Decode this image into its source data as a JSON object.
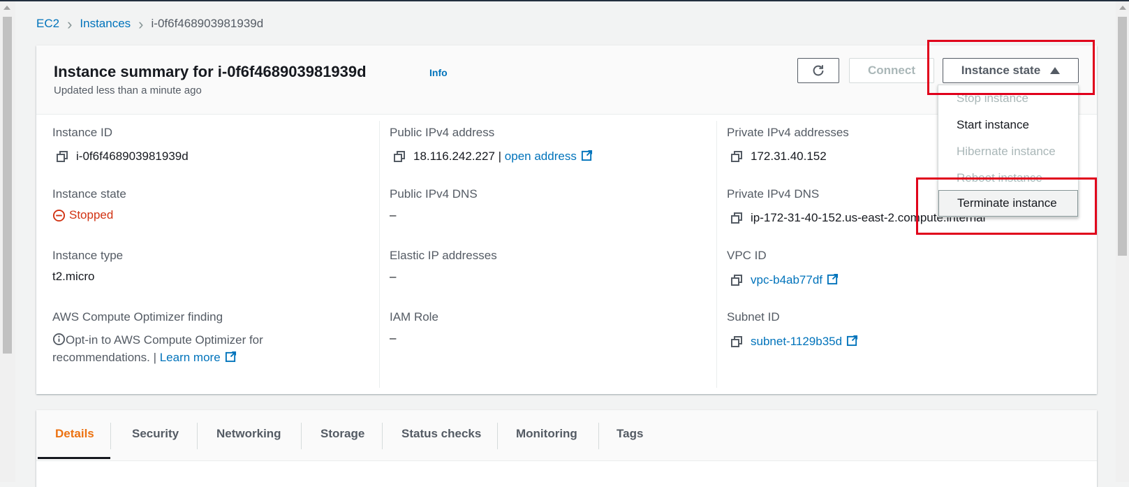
{
  "breadcrumb": {
    "items": [
      "EC2",
      "Instances"
    ],
    "current": "i-0f6f468903981939d"
  },
  "summary": {
    "title": "Instance summary for i-0f6f468903981939d",
    "info_link": "Info",
    "subtitle": "Updated less than a minute ago",
    "connect_label": "Connect",
    "instance_state_label": "Instance state"
  },
  "fields": {
    "instance_id": {
      "label": "Instance ID",
      "value": "i-0f6f468903981939d"
    },
    "instance_state": {
      "label": "Instance state",
      "value": "Stopped"
    },
    "instance_type": {
      "label": "Instance type",
      "value": "t2.micro"
    },
    "optimizer": {
      "label": "AWS Compute Optimizer finding",
      "line1": "Opt-in to AWS Compute Optimizer for",
      "line2": "recommendations. |",
      "link": "Learn more"
    },
    "public_ipv4": {
      "label": "Public IPv4 address",
      "value": "18.116.242.227 |",
      "link": "open address"
    },
    "public_dns": {
      "label": "Public IPv4 DNS",
      "value": "–"
    },
    "elastic_ip": {
      "label": "Elastic IP addresses",
      "value": "–"
    },
    "iam_role": {
      "label": "IAM Role",
      "value": "–"
    },
    "private_ipv4": {
      "label": "Private IPv4 addresses",
      "value": "172.31.40.152"
    },
    "private_dns": {
      "label": "Private IPv4 DNS",
      "value": "ip-172-31-40-152.us-east-2.compute.internal"
    },
    "vpc_id": {
      "label": "VPC ID",
      "value": "vpc-b4ab77df"
    },
    "subnet_id": {
      "label": "Subnet ID",
      "value": "subnet-1129b35d"
    }
  },
  "dropdown": {
    "items": [
      {
        "label": "Stop instance",
        "enabled": false
      },
      {
        "label": "Start instance",
        "enabled": true
      },
      {
        "label": "Hibernate instance",
        "enabled": false
      },
      {
        "label": "Reboot instance",
        "enabled": false
      },
      {
        "label": "Terminate instance",
        "enabled": true
      }
    ]
  },
  "tabs": [
    "Details",
    "Security",
    "Networking",
    "Storage",
    "Status checks",
    "Monitoring",
    "Tags"
  ],
  "colors": {
    "link": "#0073bb",
    "stopped": "#d13212",
    "active_tab": "#ec7211",
    "highlight": "#e0001b"
  }
}
